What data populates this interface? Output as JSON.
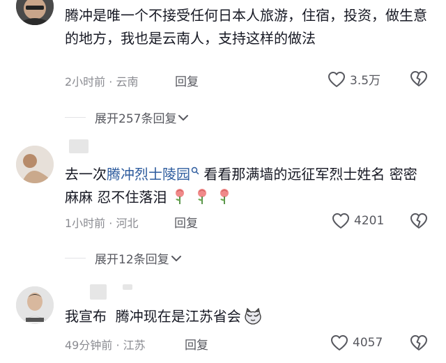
{
  "comments": [
    {
      "text": "腾冲是唯一个不接受任何日本人旅游，住宿，投资，做生意的地方，我也是云南人，支持这样的做法",
      "time": "2小时前",
      "location": "云南",
      "reply_label": "回复",
      "likes": "3.5万",
      "expand_label": "展开257条回复"
    },
    {
      "text_before": "去一次",
      "link": "腾冲烈士陵园",
      "text_after": " 看看那满墙的远征军烈士姓名 密密麻麻 忍不住落泪",
      "time": "1小时前",
      "location": "河北",
      "reply_label": "回复",
      "likes": "4201",
      "expand_label": "展开12条回复"
    },
    {
      "text": "我宣布  腾冲现在是江苏省会",
      "time": "49分钟前",
      "location": "江苏",
      "reply_label": "回复",
      "likes": "4057"
    }
  ],
  "separator": " · ",
  "colors": {
    "text": "#161823",
    "meta": "#8a8b91",
    "link": "#2e5c9e",
    "rose": "#f08a8a"
  }
}
